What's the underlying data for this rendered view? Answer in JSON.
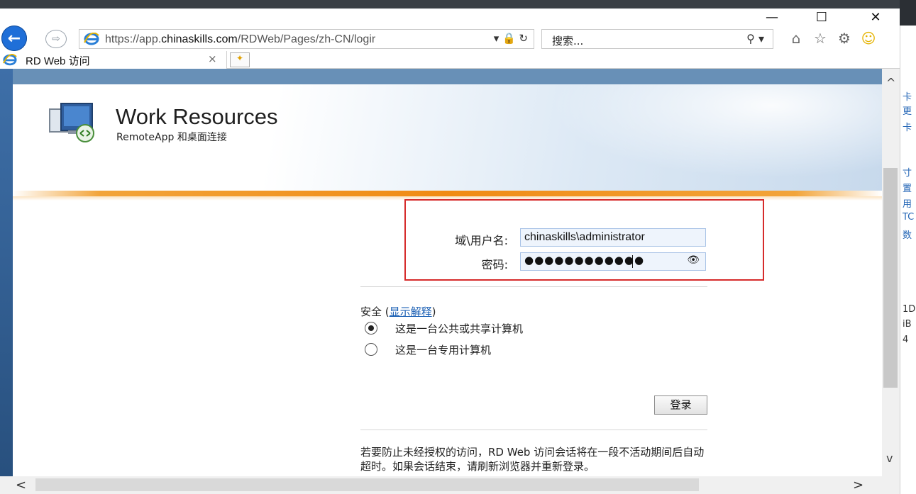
{
  "window": {
    "minimize": "—",
    "maximize": "☐",
    "close": "✕"
  },
  "nav": {
    "back": "←",
    "forward": "⇨",
    "url_prefix": "https://app.",
    "url_host": "chinaskills.com",
    "url_path": "/RDWeb/Pages/zh-CN/logir",
    "url_tools": "▾ 🔒 ↻",
    "search_placeholder": "搜索...",
    "search_icon": "⚲ ▾",
    "toolbar_icons": {
      "home": "⌂",
      "favorites": "☆",
      "settings": "⚙",
      "smile": "☺"
    }
  },
  "tab": {
    "label": "RD Web 访问",
    "close": "×"
  },
  "header": {
    "title": "Work Resources",
    "subtitle": "RemoteApp 和桌面连接"
  },
  "form": {
    "user_label": "域\\用户名:",
    "user_value": "chinaskills\\administrator",
    "pass_label": "密码:",
    "pass_value": "●●●●●●●●●●●●",
    "reveal_icon": "👁",
    "security_prefix": "安全 (",
    "security_link": "显示解释",
    "security_suffix": ")",
    "radio_public": "这是一台公共或共享计算机",
    "radio_private": "这是一台专用计算机",
    "login_button": "登录",
    "notice": "若要防止未经授权的访问，RD Web 访问会话将在一段不活动期间后自动超时。如果会话结束，请刷新浏览器并重新登录。"
  },
  "scroll": {
    "up": "^",
    "down": "v",
    "left": "<",
    "right": ">"
  },
  "right_fragments": [
    "卡",
    "更",
    "卡",
    "寸",
    "置",
    "用",
    "TC",
    "数",
    "1D",
    "iB",
    "4"
  ],
  "colors": {
    "highlight": "#d62b2b",
    "accent_orange": "#f08b14",
    "header_blue": "#6890b7",
    "link": "#1a5fb4"
  }
}
